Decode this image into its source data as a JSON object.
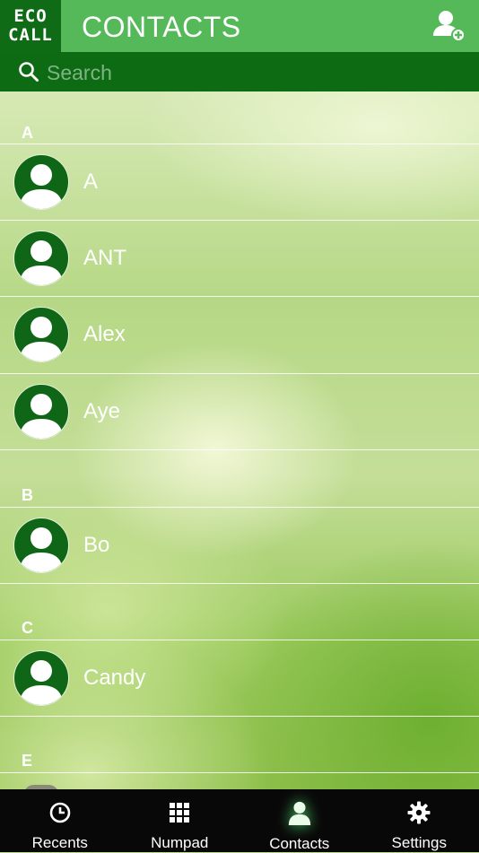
{
  "header": {
    "logo_line1": "ECO",
    "logo_line2": "CALL",
    "title": "CONTACTS"
  },
  "search": {
    "placeholder": "Search",
    "value": ""
  },
  "contacts": {
    "sections": [
      {
        "letter": "A",
        "names": [
          "A",
          "ANT",
          "Alex",
          "Aye"
        ]
      },
      {
        "letter": "B",
        "names": [
          "Bo"
        ]
      },
      {
        "letter": "C",
        "names": [
          "Candy"
        ]
      },
      {
        "letter": "E",
        "names": []
      }
    ]
  },
  "nav": {
    "items": [
      {
        "label": "Recents",
        "icon": "clock-icon"
      },
      {
        "label": "Numpad",
        "icon": "grid-icon"
      },
      {
        "label": "Contacts",
        "icon": "person-icon",
        "active": true
      },
      {
        "label": "Settings",
        "icon": "gear-icon"
      }
    ]
  },
  "colors": {
    "header": "#55b95a",
    "logo_bg": "#0f6b16",
    "search_bg": "#0d6b14",
    "avatar_bg": "#0f6616",
    "nav_bg": "#080808",
    "active_glow": "#4fd36b"
  }
}
